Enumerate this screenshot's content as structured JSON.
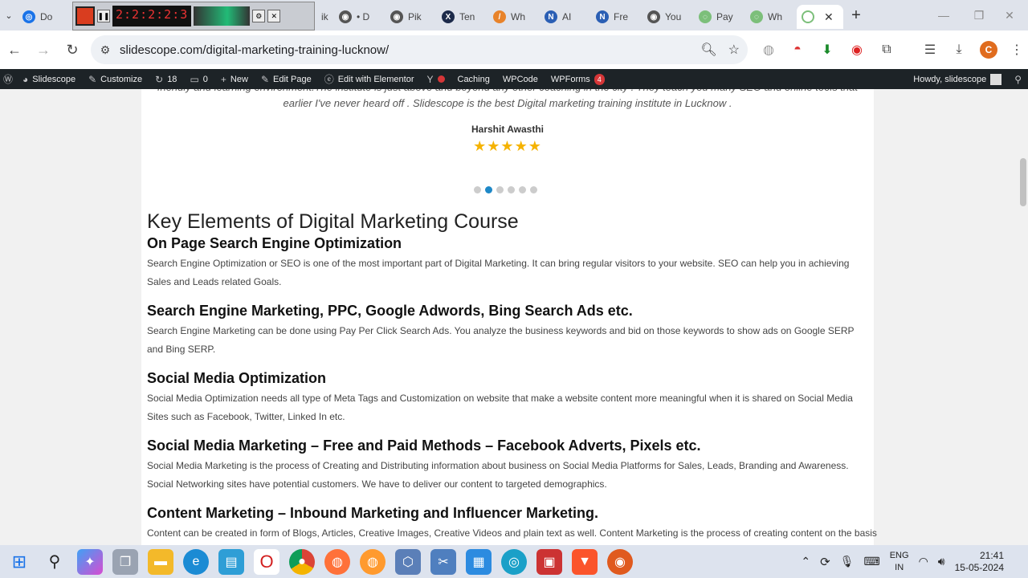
{
  "browser": {
    "tabs": [
      {
        "title": "Do",
        "color": "#1a73e8",
        "glyph": "◎"
      },
      {
        "title": "ik",
        "color": "#777",
        "glyph": ""
      },
      {
        "title": "• D",
        "color": "#555",
        "glyph": "◉"
      },
      {
        "title": "Pik",
        "color": "#555",
        "glyph": "◉"
      },
      {
        "title": "Ten",
        "color": "#1c2a4a",
        "glyph": "X"
      },
      {
        "title": "Wh",
        "color": "#e8832a",
        "glyph": "/"
      },
      {
        "title": "AI",
        "color": "#2b5fb4",
        "glyph": "N"
      },
      {
        "title": "Fre",
        "color": "#2b5fb4",
        "glyph": "N"
      },
      {
        "title": "You",
        "color": "#555",
        "glyph": "◉"
      },
      {
        "title": "Pay",
        "color": "#7cbf7a",
        "glyph": "◌"
      },
      {
        "title": "Wh",
        "color": "#7cbf7a",
        "glyph": "◌"
      }
    ],
    "recorder_time": "2:2:2:2:3",
    "address": "slidescope.com/digital-marketing-training-lucknow/",
    "profile_initial": "C"
  },
  "adminbar": {
    "site": "Slidescope",
    "customize": "Customize",
    "updates": "18",
    "comments": "0",
    "new": "New",
    "edit_page": "Edit Page",
    "elementor": "Edit with Elementor",
    "caching": "Caching",
    "wpcode": "WPCode",
    "wpforms": "WPForms",
    "wpforms_badge": "4",
    "howdy": "Howdy, slidescope"
  },
  "testimonial": {
    "line_cut": "friendly and learning environment.The institute is just above and beyond any other coaching in the city . They teach you many SEO and online tools that",
    "line": "earlier I've never heard off . Slidescope is the best Digital marketing training institute in Lucknow .",
    "author": "Harshit Awasthi",
    "stars": "★★★★★"
  },
  "main": {
    "title": "Key Elements of Digital Marketing Course",
    "sections": [
      {
        "heading": "On Page Search Engine Optimization",
        "body": "Search Engine Optimization or SEO is one of the most important part of Digital Marketing. It can bring regular visitors to your website. SEO can help you in achieving Sales and Leads related Goals."
      },
      {
        "heading": "Search Engine Marketing, PPC, Google Adwords, Bing Search Ads etc.",
        "body": "Search Engine Marketing can be done using Pay Per Click Search Ads. You analyze the business keywords and bid on those keywords to show ads on Google SERP and Bing SERP."
      },
      {
        "heading": "Social Media Optimization",
        "body": "Social Media Optimization needs all type of Meta Tags and Customization on website that make a website content more meaningful when it is shared on Social Media Sites such as Facebook, Twitter, Linked In etc."
      },
      {
        "heading": "Social Media Marketing – Free and Paid Methods – Facebook Adverts, Pixels etc.",
        "body": "Social Media Marketing is the process of Creating and Distributing information about business on Social Media Platforms for Sales, Leads, Branding and Awareness. Social Networking sites have potential customers. We have to deliver our content to targeted demographics."
      },
      {
        "heading": "Content Marketing – Inbound Marketing and Influencer Marketing.",
        "body": "Content can be created in form of Blogs, Articles, Creative Images, Creative Videos and plain text as well. Content Marketing is the process of creating content on the basis"
      }
    ]
  },
  "taskbar": {
    "lang_top": "ENG",
    "lang_bottom": "IN",
    "time": "21:41",
    "date": "15-05-2024"
  }
}
